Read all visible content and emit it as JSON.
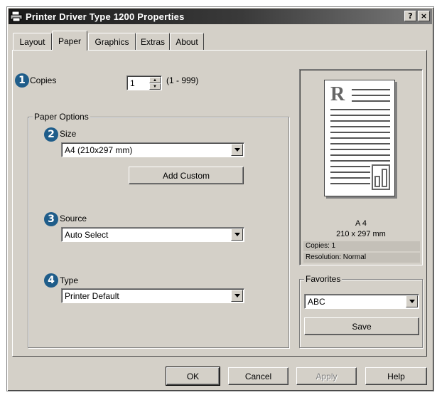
{
  "window": {
    "title": "Printer Driver Type 1200 Properties",
    "help_btn": "?",
    "close_btn": "×"
  },
  "tabs": [
    {
      "label": "Layout"
    },
    {
      "label": "Paper"
    },
    {
      "label": "Graphics"
    },
    {
      "label": "Extras"
    },
    {
      "label": "About"
    }
  ],
  "callouts": [
    "1",
    "2",
    "3",
    "4"
  ],
  "copies": {
    "label": "Copies",
    "value": "1",
    "range": "(1 - 999)"
  },
  "paper_options": {
    "title": "Paper Options",
    "size_label": "Size",
    "size_value": "A4 (210x297 mm)",
    "add_custom": "Add Custom",
    "source_label": "Source",
    "source_value": "Auto Select",
    "type_label": "Type",
    "type_value": "Printer Default"
  },
  "preview": {
    "letter": "R",
    "paper_name": "A 4",
    "paper_dims": "210 x 297 mm",
    "copies": "Copies: 1",
    "resolution": "Resolution: Normal"
  },
  "favorites": {
    "title": "Favorites",
    "value": "ABC",
    "save": "Save"
  },
  "footer": {
    "ok": "OK",
    "cancel": "Cancel",
    "apply": "Apply",
    "help": "Help"
  },
  "colors": {
    "face": "#d4d0c8",
    "callout": "#1f5d8a"
  }
}
